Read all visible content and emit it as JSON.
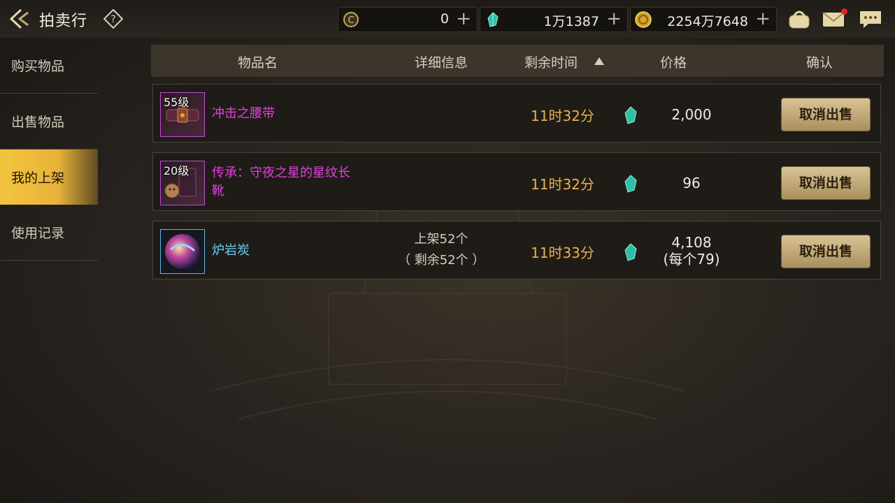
{
  "header": {
    "title": "拍卖行",
    "currencies": [
      {
        "icon": "coin-c-icon",
        "value": "0"
      },
      {
        "icon": "gem-icon",
        "value": "1万1387"
      },
      {
        "icon": "gold-coin-icon",
        "value": "2254万7648"
      }
    ]
  },
  "sidebar": {
    "items": [
      {
        "label": "购买物品"
      },
      {
        "label": "出售物品"
      },
      {
        "label": "我的上架"
      },
      {
        "label": "使用记录"
      }
    ]
  },
  "table": {
    "columns": [
      "物品名",
      "详细信息",
      "剩余时间",
      "价格",
      "确认"
    ],
    "rows": [
      {
        "level": "55级",
        "name_lines": [
          "冲击之腰带"
        ],
        "detail": [
          "",
          ""
        ],
        "time": "11时32分",
        "price": [
          "2,000",
          ""
        ],
        "action": "取消出售"
      },
      {
        "level": "20级",
        "name_lines": [
          "传承：守夜之星的星纹长",
          "靴"
        ],
        "detail": [
          "",
          ""
        ],
        "time": "11时32分",
        "price": [
          "96",
          ""
        ],
        "action": "取消出售"
      },
      {
        "level": "",
        "name_lines": [
          "炉岩炭"
        ],
        "detail": [
          "上架52个",
          "（ 剩余52个 ）"
        ],
        "time": "11时33分",
        "price": [
          "4,108",
          "(每个79)"
        ],
        "action": "取消出售"
      }
    ]
  },
  "colors": {
    "accent_gold": "#f3c53e",
    "time_orange": "#e8b24a",
    "name_purple": "#e43fe0",
    "name_cyan": "#67d1f1"
  }
}
